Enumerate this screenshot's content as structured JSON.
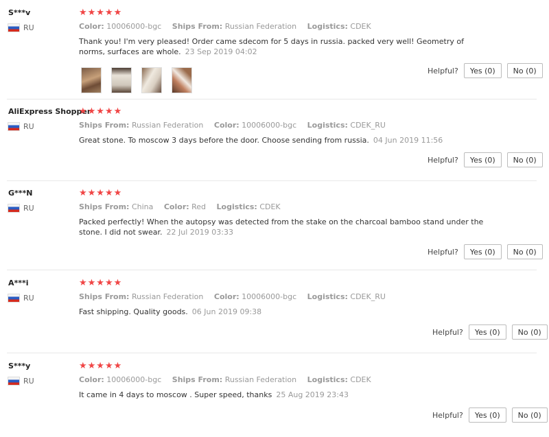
{
  "helpful_label": "Helpful?",
  "reviews": [
    {
      "user": "S***v",
      "country": "RU",
      "stars": "★★★★★",
      "meta": [
        {
          "k": "Color:",
          "v": "10006000-bgc"
        },
        {
          "k": "Ships From:",
          "v": "Russian Federation"
        },
        {
          "k": "Logistics:",
          "v": "CDEK"
        }
      ],
      "text": "Thank you! I'm very pleased! Order came sdecom for 5 days in russia. packed very well! Geometry of norms, surfaces are whole.",
      "date": "23 Sep 2019 04:02",
      "yes": "Yes (0)",
      "no": "No (0)",
      "photos": 4
    },
    {
      "user": "AliExpress Shopper",
      "country": "RU",
      "stars": "★★★★★",
      "meta": [
        {
          "k": "Ships From:",
          "v": "Russian Federation"
        },
        {
          "k": "Color:",
          "v": "10006000-bgc"
        },
        {
          "k": "Logistics:",
          "v": "CDEK_RU"
        }
      ],
      "text": "Great stone. To moscow 3 days before the door. Choose sending from russia.",
      "date": "04 Jun 2019 11:56",
      "yes": "Yes (0)",
      "no": "No (0)"
    },
    {
      "user": "G***N",
      "country": "RU",
      "stars": "★★★★★",
      "meta": [
        {
          "k": "Ships From:",
          "v": "China"
        },
        {
          "k": "Color:",
          "v": "Red"
        },
        {
          "k": "Logistics:",
          "v": "CDEK"
        }
      ],
      "text": "Packed perfectly! When the autopsy was detected from the stake on the charcoal bamboo stand under the stone. I did not swear.",
      "date": "22 Jul 2019 03:33",
      "yes": "Yes (0)",
      "no": "No (0)"
    },
    {
      "user": "A***i",
      "country": "RU",
      "stars": "★★★★★",
      "meta": [
        {
          "k": "Ships From:",
          "v": "Russian Federation"
        },
        {
          "k": "Color:",
          "v": "10006000-bgc"
        },
        {
          "k": "Logistics:",
          "v": "CDEK_RU"
        }
      ],
      "text": "Fast shipping. Quality goods.",
      "date": "06 Jun 2019 09:38",
      "yes": "Yes (0)",
      "no": "No (0)"
    },
    {
      "user": "S***y",
      "country": "RU",
      "stars": "★★★★★",
      "meta": [
        {
          "k": "Color:",
          "v": "10006000-bgc"
        },
        {
          "k": "Ships From:",
          "v": "Russian Federation"
        },
        {
          "k": "Logistics:",
          "v": "CDEK"
        }
      ],
      "text": "It came in 4 days to moscow . Super speed, thanks",
      "date": "25 Aug 2019 23:43",
      "yes": "Yes (0)",
      "no": "No (0)"
    }
  ],
  "colors": {
    "star": "#f04545",
    "meta": "#999999",
    "divider": "#e8e8e8"
  },
  "icons": {
    "star": "star-icon",
    "flag": "russia-flag-icon"
  }
}
